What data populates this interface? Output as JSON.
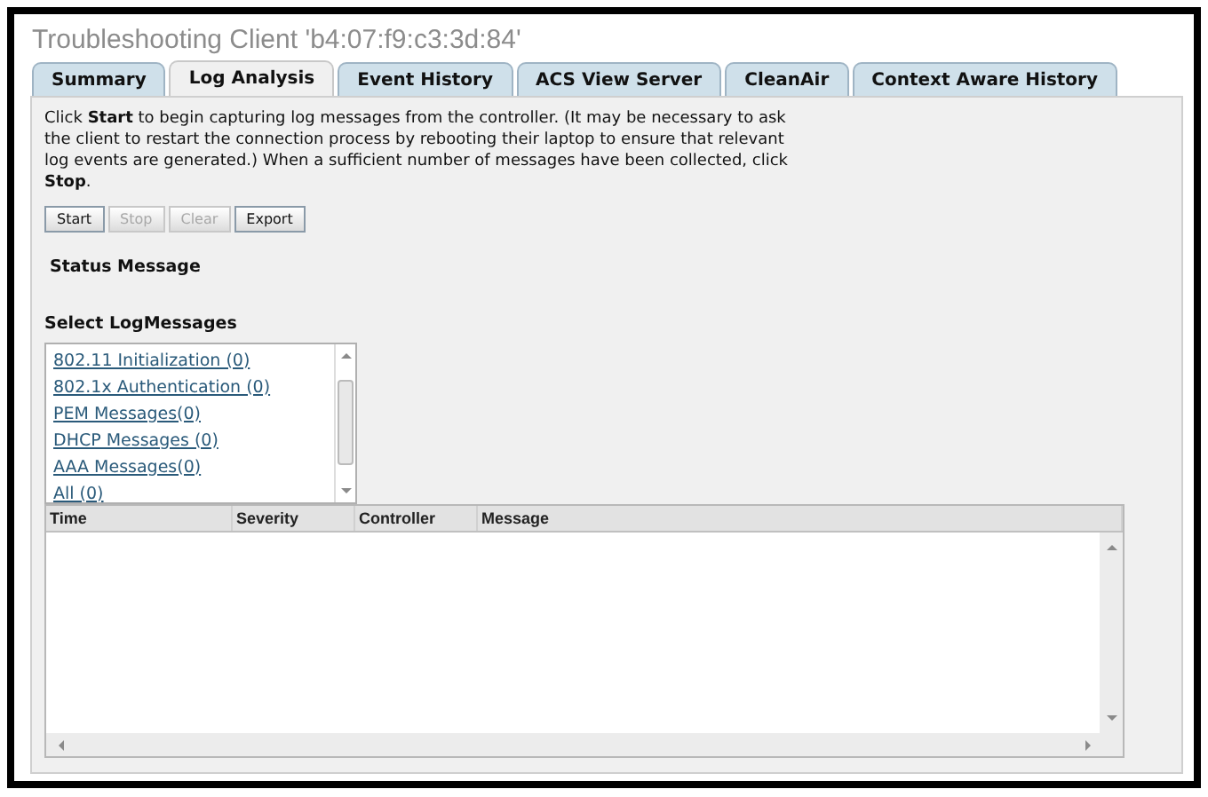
{
  "window": {
    "title": "Troubleshooting Client 'b4:07:f9:c3:3d:84'"
  },
  "tabs": [
    {
      "label": "Summary",
      "selected": false
    },
    {
      "label": "Log Analysis",
      "selected": true
    },
    {
      "label": "Event History",
      "selected": false
    },
    {
      "label": "ACS View Server",
      "selected": false
    },
    {
      "label": "CleanAir",
      "selected": false
    },
    {
      "label": "Context Aware History",
      "selected": false
    }
  ],
  "instructions": "Click **Start** to begin capturing log messages from the controller. (It may be necessary to ask the client to restart the connection process by rebooting their laptop to ensure that relevant log events are generated.) When a sufficient number of messages have been collected, click **Stop**.",
  "buttons": [
    {
      "label": "Start",
      "disabled": false
    },
    {
      "label": "Stop",
      "disabled": true
    },
    {
      "label": "Clear",
      "disabled": true
    },
    {
      "label": "Export",
      "disabled": false
    }
  ],
  "status_heading": "Status Message",
  "log_select": {
    "heading": "Select LogMessages",
    "items": [
      "802.11 Initialization (0)",
      "802.1x Authentication (0)",
      "PEM Messages(0)",
      "DHCP Messages (0)",
      "AAA Messages(0)",
      "All (0)"
    ]
  },
  "table": {
    "columns": [
      "Time",
      "Severity",
      "Controller",
      "Message"
    ]
  }
}
